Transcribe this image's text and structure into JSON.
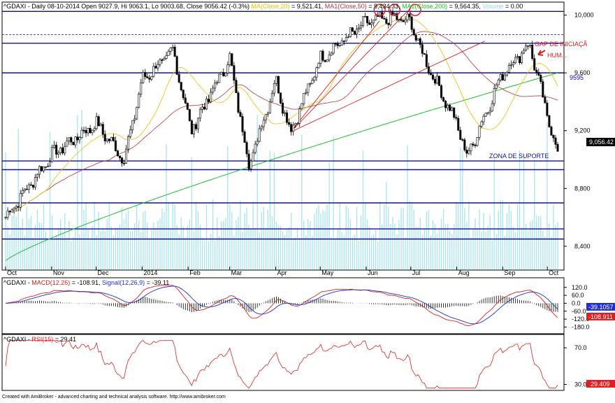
{
  "header": {
    "symbol": "^GDAXI",
    "desc": " - Daily 08-10-2014 Open 9027.9, Hi 9063.1, Lo 9003.68, Close 9056.42 (-0.3%) ",
    "ma20_label": "MA(Close,20)",
    "ma20_value": " = 9,521.41, ",
    "ma50_label": "MA1(Close,50)",
    "ma50_value": " = 9,434.33, ",
    "ma200_label": "MA2(Close,200)",
    "ma200_value": " = 9,564.35, ",
    "volume_label": "Volume",
    "volume_value": " = 0.00"
  },
  "macd_header": {
    "symbol": "^GDAXI",
    "sep": " - ",
    "macd_label": "MACD(12,26)",
    "macd_value": " = -108.91, ",
    "signal_label": "Signal(12,26,9)",
    "signal_value": " = -39.11"
  },
  "rsi_header": {
    "symbol": "^GDAXI",
    "sep": " - ",
    "rsi_label": "RSI(15)",
    "rsi_value": " = 29.41"
  },
  "annotations": {
    "gap": "GAP DE INICIAÇÃ",
    "hum": "HUM...",
    "level_9595": "9595",
    "support": "ZONA DE SUPORTE"
  },
  "footer": "Created with AmiBroker - advanced charting and technical analysis software. http://www.amibroker.com",
  "colors": {
    "up": "#000000",
    "down": "#000000",
    "ma20": "#e6c200",
    "ma50": "#c0303a",
    "ma200": "#1fbf2a",
    "volume": "#a8e4f0",
    "horizontal_lines": "#1010a0",
    "trendlines": "#e02020",
    "macd": "#e02020",
    "signal": "#2030d0",
    "rsi": "#e02020",
    "last_price_bg": "#000000",
    "macd_box": "#2030d0",
    "signal_box": "#e02020",
    "rsi_box": "#e02020"
  },
  "chart_data": [
    {
      "type": "candlestick",
      "title": "^GDAXI - Daily 08-10-2014",
      "y_axis": {
        "range": [
          8240,
          10080
        ],
        "ticks": [
          10000,
          9600,
          9200,
          8800,
          8400
        ]
      },
      "x_axis": {
        "ticks": [
          "Oct",
          "Nov",
          "Dec",
          "2014",
          "Feb",
          "Mar",
          "Apr",
          "May",
          "Jun",
          "Jul",
          "Aug",
          "Sep",
          "Oct"
        ]
      },
      "last_close": 9056.42,
      "last_close_label": "9,056.42",
      "horizontal_levels": [
        10025,
        9805,
        9600,
        8990,
        8930,
        8700,
        8520,
        8450
      ],
      "dashed_level": 9865,
      "key_points": [
        {
          "date": "2013-10-01",
          "close": 8600
        },
        {
          "date": "2013-11-01",
          "close": 9030
        },
        {
          "date": "2013-12-01",
          "close": 9250
        },
        {
          "date": "2013-12-20",
          "close": 9000
        },
        {
          "date": "2014-01-01",
          "close": 9550
        },
        {
          "date": "2014-01-22",
          "close": 9750
        },
        {
          "date": "2014-02-03",
          "close": 9200
        },
        {
          "date": "2014-03-01",
          "close": 9700
        },
        {
          "date": "2014-03-14",
          "close": 8960
        },
        {
          "date": "2014-04-01",
          "close": 9550
        },
        {
          "date": "2014-04-11",
          "close": 9190
        },
        {
          "date": "2014-05-01",
          "close": 9700
        },
        {
          "date": "2014-06-01",
          "close": 9950
        },
        {
          "date": "2014-06-20",
          "close": 9980
        },
        {
          "date": "2014-07-01",
          "close": 9950
        },
        {
          "date": "2014-07-10",
          "close": 9700
        },
        {
          "date": "2014-08-01",
          "close": 9250
        },
        {
          "date": "2014-08-08",
          "close": 9020
        },
        {
          "date": "2014-09-01",
          "close": 9600
        },
        {
          "date": "2014-09-19",
          "close": 9800
        },
        {
          "date": "2014-10-01",
          "close": 9300
        },
        {
          "date": "2014-10-08",
          "close": 9056
        }
      ],
      "moving_averages": [
        {
          "name": "MA(Close,20)",
          "last": 9521.41
        },
        {
          "name": "MA1(Close,50)",
          "last": 9434.33
        },
        {
          "name": "MA2(Close,200)",
          "last": 9564.35
        }
      ]
    },
    {
      "type": "line",
      "y_axis": {
        "range": [
          -220,
          140
        ],
        "ticks": [
          120.0,
          60.0,
          0.0,
          -60.0,
          -120.0,
          -180.0
        ]
      },
      "series": [
        {
          "name": "MACD(12,26)",
          "last": -108.91
        },
        {
          "name": "Signal(12,26,9)",
          "last": -39.11
        }
      ],
      "labels": {
        "macd": "-108.911",
        "signal": "-39.1057"
      }
    },
    {
      "type": "line",
      "y_axis": {
        "range": [
          25,
          80
        ],
        "ticks": [
          70.0,
          30.0
        ]
      },
      "series": [
        {
          "name": "RSI(15)",
          "last": 29.41
        }
      ],
      "labels": {
        "rsi": "29.409"
      }
    }
  ]
}
